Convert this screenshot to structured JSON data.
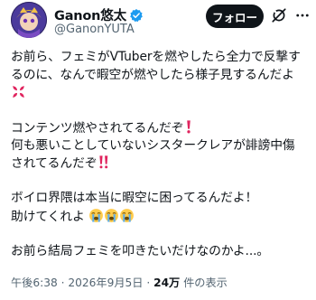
{
  "author": {
    "display_name": "Ganon悠太",
    "handle": "@GanonYUTA"
  },
  "actions": {
    "follow_label": "フォロー"
  },
  "icons": {
    "verified": "verified-badge-icon",
    "grok": "grok-icon",
    "more": "more-options-icon",
    "anger": "anger-symbol-emoji",
    "exclamation": "red-exclamation-emoji",
    "double_exclamation": "red-double-exclamation-emoji",
    "crying": "loudly-crying-face-emoji"
  },
  "colors": {
    "verified": "#1d9bf0",
    "follow_button_bg": "#000000",
    "exclamation": "#e0245e"
  },
  "post": {
    "lines": [
      "お前ら、フェミがVTuberを燃やしたら全力で反撃す",
      "るのに、なんで暇空が燃やしたら様子見するんだよ",
      "コンテンツ燃やされてるんだぞ",
      "何も悪いことしていないシスタークレアが誹謗中傷",
      "されてるんだぞ",
      "ボイロ界隈は本当に暇空に困ってるんだよ！",
      "助けてくれよ",
      "お前ら結局フェミを叩きたいだけなのかよ...。"
    ]
  },
  "meta": {
    "time": "午後6:38",
    "separator": "·",
    "date": "2026年9月5日",
    "views_count": "24万",
    "views_label": "件の表示"
  }
}
